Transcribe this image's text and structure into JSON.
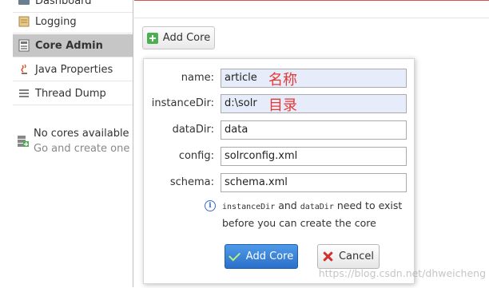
{
  "sidebar": {
    "items": [
      {
        "label": "Dashboard",
        "icon": "dashboard-icon"
      },
      {
        "label": "Logging",
        "icon": "logging-icon"
      },
      {
        "label": "Core Admin",
        "icon": "core-admin-icon",
        "active": true
      },
      {
        "label": "Java Properties",
        "icon": "java-properties-icon"
      },
      {
        "label": "Thread Dump",
        "icon": "thread-dump-icon"
      }
    ],
    "no_cores": {
      "line1": "No cores available",
      "line2": "Go and create one"
    }
  },
  "toolbar": {
    "add_core_label": "Add Core"
  },
  "dialog": {
    "fields": [
      {
        "label": "name:",
        "value": "article",
        "annotation": "名称"
      },
      {
        "label": "instanceDir:",
        "value": "d:\\solr",
        "annotation": "目录"
      },
      {
        "label": "dataDir:",
        "value": "data"
      },
      {
        "label": "config:",
        "value": "solrconfig.xml"
      },
      {
        "label": "schema:",
        "value": "schema.xml"
      }
    ],
    "hint": {
      "code1": "instanceDir",
      "and": " and ",
      "code2": "dataDir",
      "rest": " need to exist before you can create the core"
    },
    "add_label": "Add Core",
    "cancel_label": "Cancel"
  },
  "watermark": "https://blog.csdn.net/dhweicheng",
  "colors": {
    "accent": "#2b6fc9",
    "annotation": "#e53935",
    "active_nav": "#c6c6c6"
  }
}
